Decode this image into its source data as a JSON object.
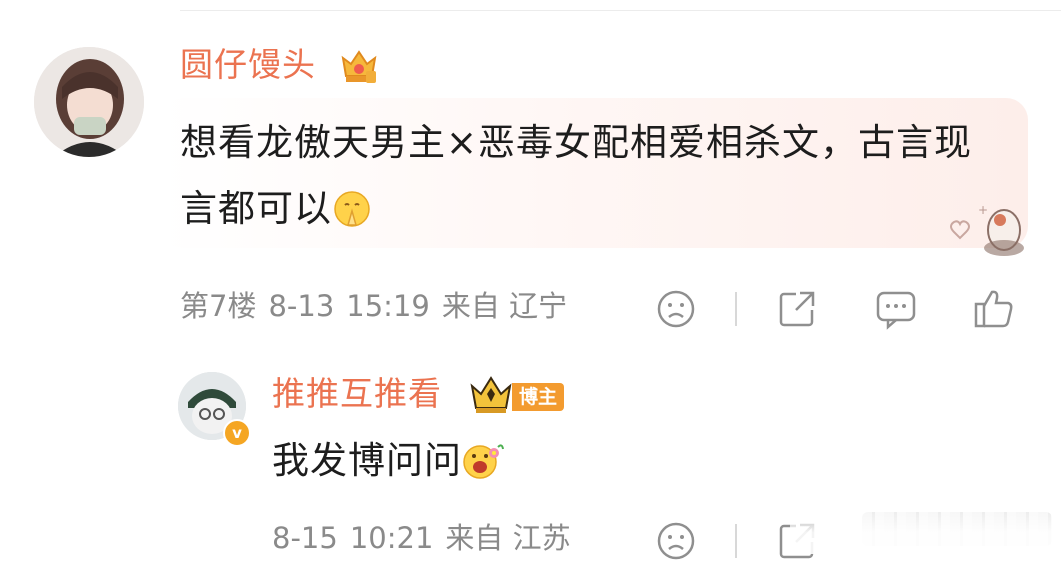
{
  "comment": {
    "username": "圆仔馒头",
    "text": "想看龙傲天男主×恶毒女配相爱相杀文，古言现言都可以",
    "floor": "第7楼",
    "date": "8-13",
    "time": "15:19",
    "location": "来自 辽宁"
  },
  "reply": {
    "username": "推推互推看",
    "badge": "博主",
    "text": "我发博问问",
    "date": "8-15",
    "time": "10:21",
    "location": "来自 江苏"
  },
  "icons": {
    "crown_badge": "crown-icon",
    "pray_emoji": "praying-face-emoji",
    "happy_emoji": "happy-flower-emoji",
    "dislike": "frown-face-icon",
    "repost": "share-icon",
    "reply": "comment-icon",
    "like": "thumbs-up-icon"
  },
  "colors": {
    "username": "#eb7350",
    "meta": "#8a8a8a",
    "blogger_tag": "#f39b2f"
  }
}
